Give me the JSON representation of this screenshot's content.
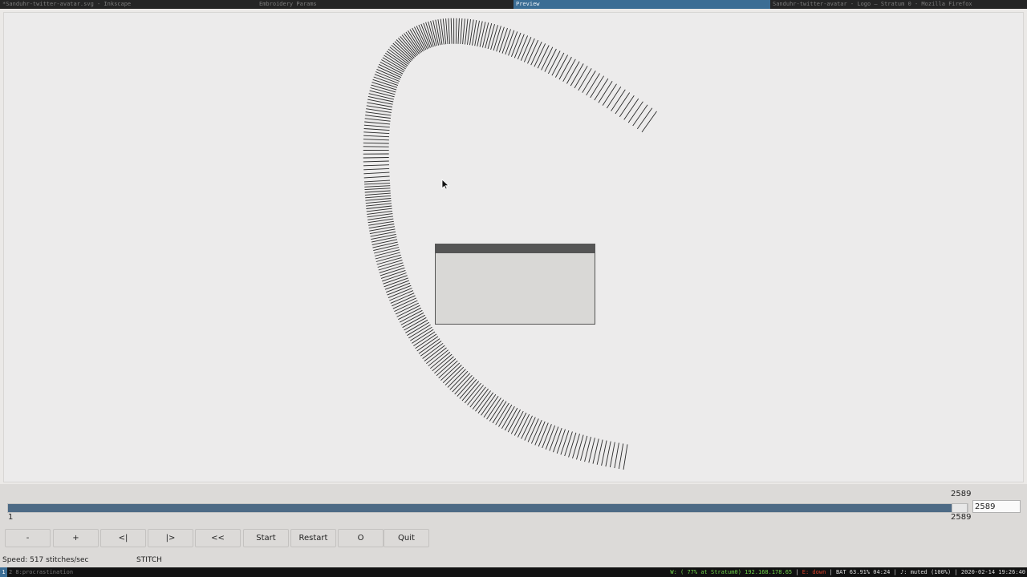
{
  "window_tabs": [
    {
      "title": "*Sanduhr-twitter-avatar.svg - Inkscape",
      "active": false
    },
    {
      "title": "Embroidery Params",
      "active": false
    },
    {
      "title": "Preview",
      "active": true
    },
    {
      "title": "Sanduhr-twitter-avatar - Logo – Stratum 0 - Mozilla Firefox",
      "active": false
    }
  ],
  "slider": {
    "current_top": "2589",
    "min_label": "1",
    "max_label": "2589",
    "input_value": "2589",
    "fraction": 1.0
  },
  "buttons": [
    {
      "label": "-"
    },
    {
      "label": "+"
    },
    {
      "label": "<|"
    },
    {
      "label": "|>"
    },
    {
      "label": "<<"
    },
    {
      "label": "Start"
    },
    {
      "label": "Restart"
    },
    {
      "label": "O"
    },
    {
      "label": "Quit"
    }
  ],
  "status": {
    "speed": "Speed: 517 stitches/sec",
    "mode": "STITCH"
  },
  "statusbar": {
    "workspace_active": "1",
    "workspace_other": "2 8:procrastination",
    "wifi": "W: ( 77% at Stratum0) 192.168.178.65",
    "eth": "E: down",
    "battery": "BAT 63.91% 04:24",
    "volume": "♪: muted (100%)",
    "datetime": "2020-02-14 19:26:40"
  },
  "colors": {
    "accent": "#3b6d94",
    "slider_fill": "#4d6a85",
    "stitch": "#2a2a2a"
  }
}
